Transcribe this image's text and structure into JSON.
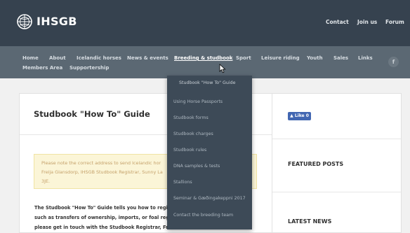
{
  "brand": {
    "name": "IHSGB"
  },
  "top_links": [
    "Contact",
    "Join us",
    "Forum"
  ],
  "nav": {
    "row1": [
      "Home",
      "About",
      "Icelandic horses",
      "News & events",
      "Breeding & studbook",
      "Sport",
      "Leisure riding",
      "Youth",
      "Sales",
      "Links"
    ],
    "row2": [
      "Members Area",
      "Supportership"
    ],
    "active": "Breeding & studbook",
    "social_label": "f"
  },
  "dropdown": {
    "items": [
      "Studbook \"How To\" Guide",
      "Using Horse Passports",
      "Studbook forms",
      "Studbook charges",
      "Studbook rules",
      "DNA samples & tests",
      "Stallions",
      "Seminar & Gæðingakeppni 2017",
      "Contact the breeding team"
    ]
  },
  "main": {
    "title": "Studbook \"How To\" Guide",
    "notice_lines": [
      "Please note the correct address to send Icelandic hor",
      "Freija Glansdorp, IHSGB Studbook Registrar, Sunny La",
      "3JE."
    ],
    "body_lines": [
      "The Studbook \"How To\" Guide tells you how to regis",
      "such as transfers of ownership, imports, or foal regi",
      "please get in touch with the Studbook Registrar, Fre"
    ]
  },
  "sidebar": {
    "like_label": "Like 0",
    "featured_heading": "FEATURED POSTS",
    "latest_heading": "LATEST NEWS"
  },
  "colors": {
    "header_bg": "#36424f",
    "nav_bg": "#5b6873",
    "dropdown_bg": "#3d4a57",
    "notice_bg": "#fbf5d7",
    "notice_text": "#c4a06a",
    "facebook_blue": "#4267b2"
  }
}
